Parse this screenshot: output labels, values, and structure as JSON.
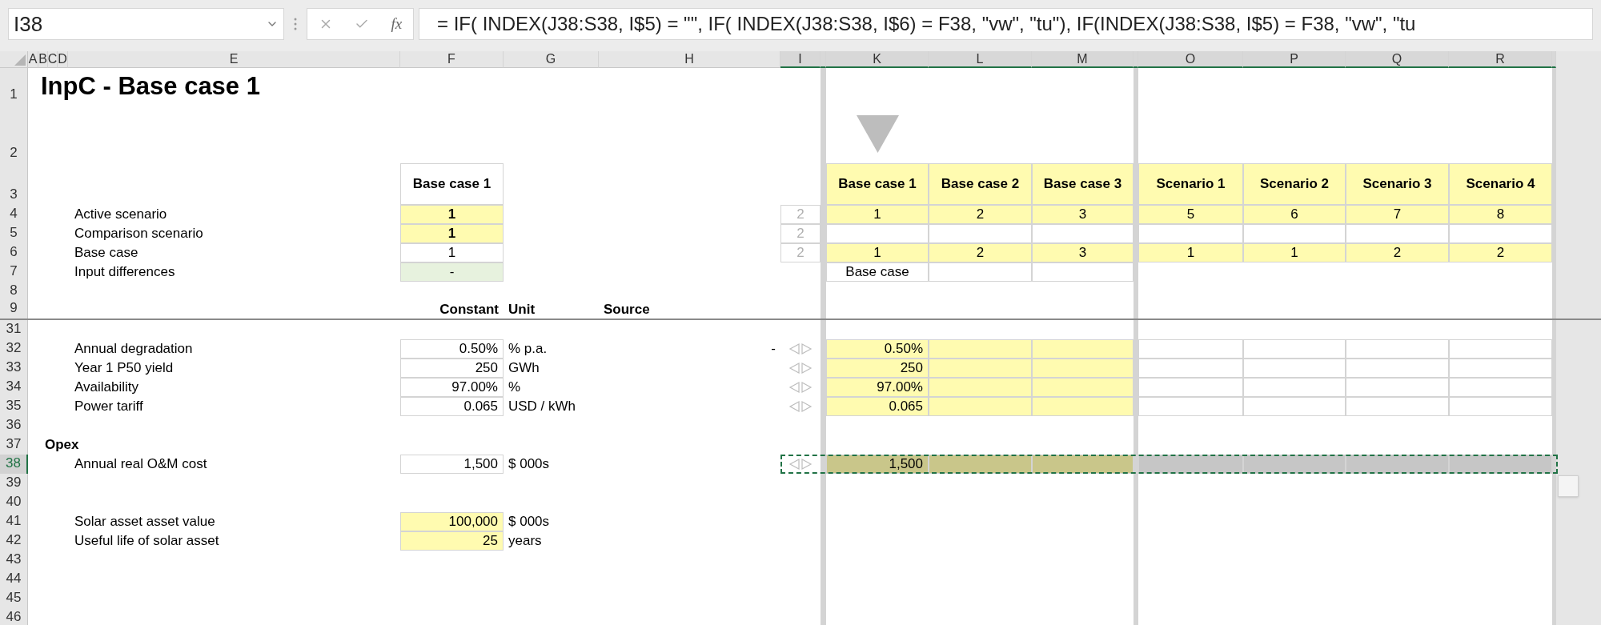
{
  "name_box": {
    "value": "I38"
  },
  "formula_bar": {
    "function_label": "fx",
    "formula": "= IF( INDEX(J38:S38, I$5) = \"\", IF( INDEX(J38:S38, I$6) = F38, \"vw\", \"tu\"), IF(INDEX(J38:S38, I$5) = F38, \"vw\", \"tu"
  },
  "column_headers": [
    {
      "letter": "A",
      "selected": false
    },
    {
      "letter": "B",
      "selected": false
    },
    {
      "letter": "C",
      "selected": false
    },
    {
      "letter": "D",
      "selected": false
    },
    {
      "letter": "E",
      "selected": false
    },
    {
      "letter": "F",
      "selected": false
    },
    {
      "letter": "G",
      "selected": false
    },
    {
      "letter": "H",
      "selected": false
    },
    {
      "letter": "I",
      "selected": true
    },
    {
      "selected": true
    },
    {
      "letter": "K",
      "selected": true
    },
    {
      "letter": "L",
      "selected": true
    },
    {
      "letter": "M",
      "selected": true
    },
    {
      "selected": true
    },
    {
      "letter": "O",
      "selected": true
    },
    {
      "letter": "P",
      "selected": true
    },
    {
      "letter": "Q",
      "selected": true
    },
    {
      "letter": "R",
      "selected": true
    },
    {
      "selected": true
    }
  ],
  "rows": [
    {
      "number": "1",
      "selected": false,
      "cells": {
        "b": {
          "kind": "title",
          "text": "InpC - Base case 1",
          "bold": true
        }
      }
    },
    {
      "number": "2",
      "selected": false,
      "cells": {
        "k": {
          "kind": "marker"
        }
      }
    },
    {
      "number": "3",
      "selected": false,
      "cells": {
        "f": {
          "text": "Base case 1",
          "bold": true,
          "border": true,
          "centered": true
        },
        "k": {
          "text": "Base case 1",
          "bold": true,
          "kind": "input",
          "border": true,
          "centered": true
        },
        "l": {
          "text": "Base case 2",
          "bold": true,
          "kind": "input",
          "border": true,
          "centered": true
        },
        "m": {
          "text": "Base case 3",
          "bold": true,
          "kind": "input",
          "border": true,
          "centered": true
        },
        "o": {
          "text": "Scenario 1",
          "bold": true,
          "kind": "input",
          "border": true,
          "centered": true
        },
        "p": {
          "text": "Scenario 2",
          "bold": true,
          "kind": "input",
          "border": true,
          "centered": true
        },
        "q": {
          "text": "Scenario 3",
          "bold": true,
          "kind": "input",
          "border": true,
          "centered": true
        },
        "r": {
          "text": "Scenario 4",
          "bold": true,
          "kind": "input",
          "border": true,
          "centered": true
        }
      }
    },
    {
      "number": "4",
      "selected": false,
      "cells": {
        "e": {
          "text": "Active scenario"
        },
        "f": {
          "text": "1",
          "bold": true,
          "kind": "input",
          "border": true,
          "centered": true
        },
        "i": {
          "text": "2",
          "muted": true,
          "border": true,
          "centered": true
        },
        "k": {
          "text": "1",
          "kind": "input",
          "border": true,
          "centered": true
        },
        "l": {
          "text": "2",
          "kind": "input",
          "border": true,
          "centered": true
        },
        "m": {
          "text": "3",
          "kind": "input",
          "border": true,
          "centered": true
        },
        "o": {
          "text": "5",
          "kind": "input",
          "border": true,
          "centered": true
        },
        "p": {
          "text": "6",
          "kind": "input",
          "border": true,
          "centered": true
        },
        "q": {
          "text": "7",
          "kind": "input",
          "border": true,
          "centered": true
        },
        "r": {
          "text": "8",
          "kind": "input",
          "border": true,
          "centered": true
        }
      }
    },
    {
      "number": "5",
      "selected": false,
      "cells": {
        "e": {
          "text": "Comparison scenario"
        },
        "f": {
          "text": "1",
          "bold": true,
          "kind": "input",
          "border": true,
          "centered": true
        },
        "i": {
          "text": "2",
          "muted": true,
          "border": true,
          "centered": true
        },
        "k": {
          "border": true
        },
        "l": {
          "border": true
        },
        "m": {
          "border": true
        },
        "o": {
          "border": true
        },
        "p": {
          "border": true
        },
        "q": {
          "border": true
        },
        "r": {
          "border": true
        }
      }
    },
    {
      "number": "6",
      "selected": false,
      "cells": {
        "e": {
          "text": "Base case"
        },
        "f": {
          "text": "1",
          "border": true,
          "centered": true
        },
        "i": {
          "text": "2",
          "muted": true,
          "border": true,
          "centered": true
        },
        "k": {
          "text": "1",
          "kind": "input",
          "border": true,
          "centered": true
        },
        "l": {
          "text": "2",
          "kind": "input",
          "border": true,
          "centered": true
        },
        "m": {
          "text": "3",
          "kind": "input",
          "border": true,
          "centered": true
        },
        "o": {
          "text": "1",
          "kind": "input",
          "border": true,
          "centered": true
        },
        "p": {
          "text": "1",
          "kind": "input",
          "border": true,
          "centered": true
        },
        "q": {
          "text": "2",
          "kind": "input",
          "border": true,
          "centered": true
        },
        "r": {
          "text": "2",
          "kind": "input",
          "border": true,
          "centered": true
        }
      }
    },
    {
      "number": "7",
      "selected": false,
      "cells": {
        "e": {
          "text": "Input differences"
        },
        "f": {
          "text": "-",
          "kind": "check",
          "border": true,
          "centered": true
        },
        "k": {
          "text": "Base case",
          "border": true,
          "centered": true
        },
        "l": {
          "border": true
        },
        "m": {
          "border": true
        }
      }
    },
    {
      "number": "8",
      "selected": false,
      "cells": {}
    },
    {
      "number": "9",
      "selected": false,
      "cells": {
        "f": {
          "text": "Constant",
          "bold": true,
          "right_aligned": true
        },
        "g": {
          "text": "Unit",
          "bold": true
        },
        "h": {
          "text": "Source",
          "bold": true
        }
      }
    },
    {
      "number": "31",
      "selected": false,
      "cells": {}
    },
    {
      "number": "32",
      "selected": false,
      "cells": {
        "e": {
          "text": "Annual degradation"
        },
        "f": {
          "text": "0.50%",
          "border": true,
          "right_aligned": true
        },
        "g": {
          "text": "% p.a."
        },
        "h": {
          "text": "-",
          "right_aligned": true
        },
        "i": {
          "kind": "arrows"
        },
        "k": {
          "text": "0.50%",
          "kind": "input",
          "border": true,
          "right_aligned": true
        },
        "l": {
          "kind": "input",
          "border": true
        },
        "m": {
          "kind": "input",
          "border": true
        },
        "o": {
          "border": true
        },
        "p": {
          "border": true
        },
        "q": {
          "border": true
        },
        "r": {
          "border": true
        }
      }
    },
    {
      "number": "33",
      "selected": false,
      "cells": {
        "e": {
          "text": "Year 1 P50 yield"
        },
        "f": {
          "text": "250",
          "border": true,
          "right_aligned": true
        },
        "g": {
          "text": "GWh"
        },
        "i": {
          "kind": "arrows"
        },
        "k": {
          "text": "250",
          "kind": "input",
          "border": true,
          "right_aligned": true
        },
        "l": {
          "kind": "input",
          "border": true
        },
        "m": {
          "kind": "input",
          "border": true
        },
        "o": {
          "border": true
        },
        "p": {
          "border": true
        },
        "q": {
          "border": true
        },
        "r": {
          "border": true
        }
      }
    },
    {
      "number": "34",
      "selected": false,
      "cells": {
        "e": {
          "text": "Availability"
        },
        "f": {
          "text": "97.00%",
          "border": true,
          "right_aligned": true
        },
        "g": {
          "text": "%"
        },
        "i": {
          "kind": "arrows"
        },
        "k": {
          "text": "97.00%",
          "kind": "input",
          "border": true,
          "right_aligned": true
        },
        "l": {
          "kind": "input",
          "border": true
        },
        "m": {
          "kind": "input",
          "border": true
        },
        "o": {
          "border": true
        },
        "p": {
          "border": true
        },
        "q": {
          "border": true
        },
        "r": {
          "border": true
        }
      }
    },
    {
      "number": "35",
      "selected": false,
      "cells": {
        "e": {
          "text": "Power tariff"
        },
        "f": {
          "text": "0.065",
          "border": true,
          "right_aligned": true
        },
        "g": {
          "text": "USD / kWh"
        },
        "i": {
          "kind": "arrows"
        },
        "k": {
          "text": "0.065",
          "kind": "input",
          "border": true,
          "right_aligned": true
        },
        "l": {
          "kind": "input",
          "border": true
        },
        "m": {
          "kind": "input",
          "border": true
        },
        "o": {
          "border": true
        },
        "p": {
          "border": true
        },
        "q": {
          "border": true
        },
        "r": {
          "border": true
        }
      }
    },
    {
      "number": "36",
      "selected": false,
      "cells": {}
    },
    {
      "number": "37",
      "selected": false,
      "cells": {
        "b": {
          "text": "Opex",
          "bold": true
        }
      }
    },
    {
      "number": "38",
      "selected": true,
      "cells": {
        "e": {
          "text": "Annual real O&M cost"
        },
        "f": {
          "text": "1,500",
          "border": true,
          "right_aligned": true
        },
        "g": {
          "text": "$ 000s"
        },
        "i": {
          "kind": "arrows"
        },
        "k": {
          "text": "1,500",
          "kind": "input",
          "border": true,
          "right_aligned": true
        },
        "l": {
          "kind": "input",
          "border": true
        },
        "m": {
          "kind": "input",
          "border": true
        },
        "o": {
          "border": true
        },
        "p": {
          "border": true
        },
        "q": {
          "border": true
        },
        "r": {
          "border": true
        }
      }
    },
    {
      "number": "39",
      "selected": false,
      "cells": {}
    },
    {
      "number": "40",
      "selected": false,
      "cells": {}
    },
    {
      "number": "41",
      "selected": false,
      "cells": {
        "e": {
          "text": "Solar asset asset value"
        },
        "f": {
          "text": "100,000",
          "kind": "input",
          "border": true,
          "right_aligned": true
        },
        "g": {
          "text": "$ 000s"
        }
      }
    },
    {
      "number": "42",
      "selected": false,
      "cells": {
        "e": {
          "text": "Useful life of solar asset"
        },
        "f": {
          "text": "25",
          "kind": "input",
          "border": true,
          "right_aligned": true
        },
        "g": {
          "text": "years"
        }
      }
    },
    {
      "number": "43",
      "selected": false,
      "cells": {}
    },
    {
      "number": "44",
      "selected": false,
      "cells": {}
    },
    {
      "number": "45",
      "selected": false,
      "cells": {}
    },
    {
      "number": "46",
      "selected": false,
      "cells": {}
    }
  ]
}
